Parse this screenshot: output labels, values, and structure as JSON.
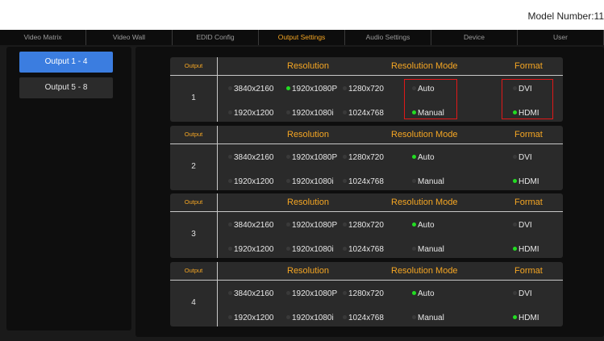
{
  "header": {
    "model_number": "Model Number:11"
  },
  "nav": {
    "tabs": [
      "Video Matrix",
      "Video Wall",
      "EDID Config",
      "Output Settings",
      "Audio Settings",
      "Device",
      "User"
    ],
    "active": "Output Settings"
  },
  "sidebar": {
    "buttons": [
      "Output 1 - 4",
      "Output 5 - 8"
    ],
    "active": "Output 1 - 4"
  },
  "table_header": {
    "output": "Output",
    "resolution": "Resolution",
    "mode": "Resolution Mode",
    "format": "Format"
  },
  "options": {
    "res_row1": [
      "3840x2160",
      "1920x1080P",
      "1280x720"
    ],
    "res_row2": [
      "1920x1200",
      "1920x1080i",
      "1024x768"
    ],
    "modes": [
      "Auto",
      "Manual"
    ],
    "formats": [
      "DVI",
      "HDMI"
    ]
  },
  "outputs": [
    {
      "number": "1",
      "resolution": "1920x1080P",
      "mode": "Manual",
      "format": "HDMI"
    },
    {
      "number": "2",
      "resolution": "",
      "mode": "Auto",
      "format": "HDMI"
    },
    {
      "number": "3",
      "resolution": "",
      "mode": "Auto",
      "format": "HDMI"
    },
    {
      "number": "4",
      "resolution": "",
      "mode": "Auto",
      "format": "HDMI"
    }
  ],
  "colors": {
    "accent": "#f5a623",
    "selected_dot": "#22dd22",
    "active_sidebar": "#3b7de0",
    "highlight": "#e01818"
  }
}
